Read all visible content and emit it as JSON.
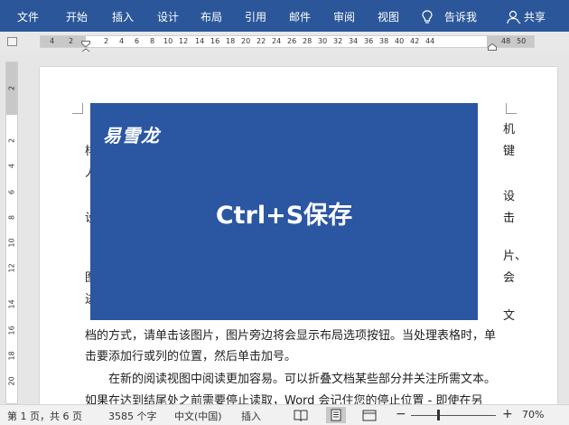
{
  "ribbon": {
    "tabs": [
      "文件",
      "开始",
      "插入",
      "设计",
      "布局",
      "引用",
      "邮件",
      "审阅",
      "视图"
    ],
    "tell_me": "告诉我",
    "share": "共享",
    "colors": {
      "bar": "#2b579a",
      "text": "#ffffff"
    }
  },
  "ruler": {
    "h_numbers": [
      "4",
      "2",
      "2",
      "4",
      "6",
      "8",
      "10",
      "12",
      "14",
      "16",
      "18",
      "20",
      "22",
      "24",
      "26",
      "28",
      "30",
      "32",
      "34",
      "36",
      "38",
      "40",
      "42",
      "44",
      "48",
      "50"
    ],
    "v_numbers": [
      "2",
      "2",
      "4",
      "6",
      "8",
      "10",
      "12",
      "14",
      "16",
      "18",
      "20"
    ]
  },
  "document": {
    "right_frags": [
      "机",
      "键",
      "设",
      "击",
      "片、",
      "会",
      "文"
    ],
    "left_frags": [
      "样",
      "人",
      "设",
      "图",
      "进"
    ],
    "line_a": "档的方式，请单击该图片，图片旁边将会显示布局选项按钮。当处理表格时，单",
    "line_b": "击要添加行或列的位置，然后单击加号。",
    "line_c": "在新的阅读视图中阅读更加容易。可以折叠文档某些部分并关注所需文本。",
    "line_d": "如果在达到结尾处之前需要停止读取，Word 会记住您的停止位置 - 即使在另"
  },
  "overlay": {
    "brand": "易雪龙",
    "title": "Ctrl+S保存",
    "color": "#2a56a2"
  },
  "status": {
    "page": "第 1 页，共 6 页",
    "words": "3585 个字",
    "language": "中文(中国)",
    "mode": "插入",
    "zoom": "70%",
    "zoom_percent": 70
  }
}
